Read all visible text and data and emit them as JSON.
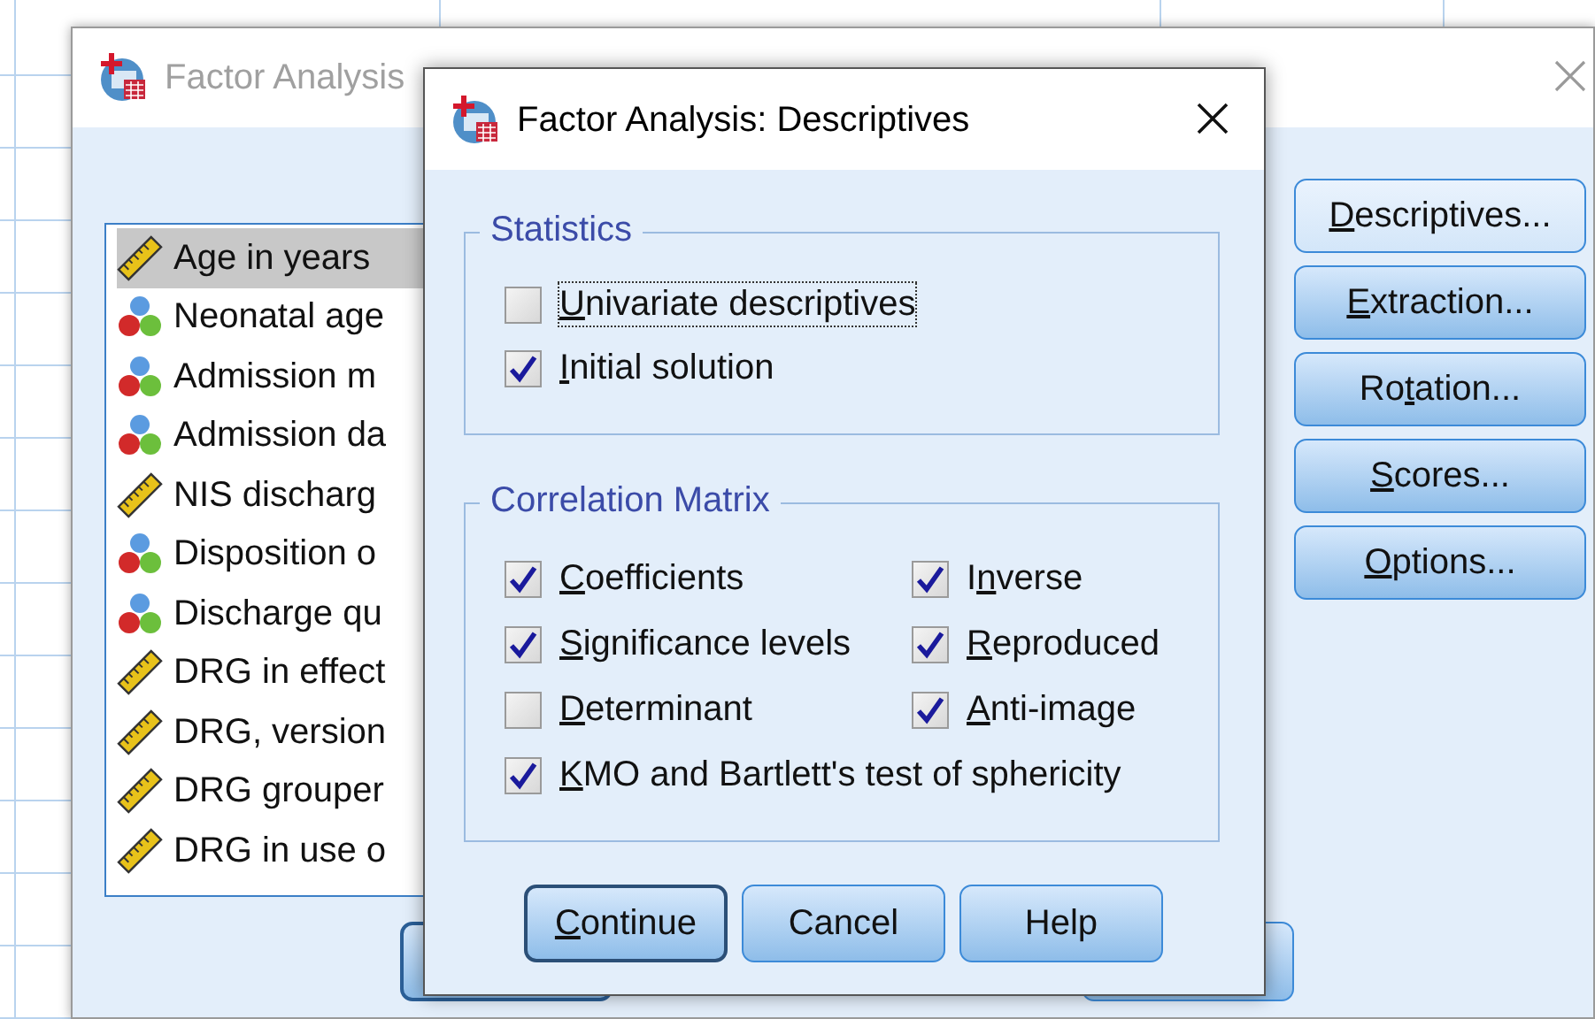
{
  "back_dialog": {
    "title": "Factor Analysis",
    "variables": [
      {
        "label": "Age in years",
        "kind": "scale",
        "selected": true
      },
      {
        "label": "Neonatal age",
        "kind": "nominal",
        "selected": false
      },
      {
        "label": "Admission m",
        "kind": "nominal",
        "selected": false
      },
      {
        "label": "Admission da",
        "kind": "nominal",
        "selected": false
      },
      {
        "label": "NIS discharg",
        "kind": "scale",
        "selected": false
      },
      {
        "label": "Disposition o",
        "kind": "nominal",
        "selected": false
      },
      {
        "label": "Discharge qu",
        "kind": "nominal",
        "selected": false
      },
      {
        "label": "DRG in effect",
        "kind": "scale",
        "selected": false
      },
      {
        "label": "DRG, version",
        "kind": "scale",
        "selected": false
      },
      {
        "label": "DRG grouper",
        "kind": "scale",
        "selected": false
      },
      {
        "label": "DRG in use o",
        "kind": "scale",
        "selected": false
      }
    ],
    "side_buttons": [
      {
        "key": "D",
        "rest": "escriptives...",
        "selected": true
      },
      {
        "key": "E",
        "rest": "xtraction...",
        "selected": false
      },
      {
        "before": "Ro",
        "key": "t",
        "rest": "ation...",
        "selected": false
      },
      {
        "key": "S",
        "rest": "cores...",
        "selected": false
      },
      {
        "key": "O",
        "rest": "ptions...",
        "selected": false
      }
    ]
  },
  "dialog": {
    "title": "Factor Analysis: Descriptives",
    "statistics": {
      "legend": "Statistics",
      "options": [
        {
          "key": "U",
          "rest": "nivariate descriptives",
          "checked": false,
          "focused": true
        },
        {
          "key": "I",
          "rest": "nitial solution",
          "checked": true,
          "focused": false
        }
      ]
    },
    "correlation_matrix": {
      "legend": "Correlation Matrix",
      "options": [
        {
          "key": "C",
          "rest": "oefficients",
          "checked": true
        },
        {
          "before": "I",
          "key": "n",
          "rest": "verse",
          "checked": true
        },
        {
          "key": "S",
          "rest": "ignificance levels",
          "checked": true
        },
        {
          "key": "R",
          "rest": "eproduced",
          "checked": true
        },
        {
          "key": "D",
          "rest": "eterminant",
          "checked": false
        },
        {
          "key": "A",
          "rest": "nti-image",
          "checked": true
        },
        {
          "key": "K",
          "rest": "MO and Bartlett's test of sphericity",
          "checked": true
        }
      ]
    },
    "buttons": [
      {
        "key": "C",
        "rest": "ontinue",
        "default": true
      },
      {
        "rest": "Cancel",
        "default": false
      },
      {
        "rest": "Help",
        "default": false
      }
    ]
  }
}
